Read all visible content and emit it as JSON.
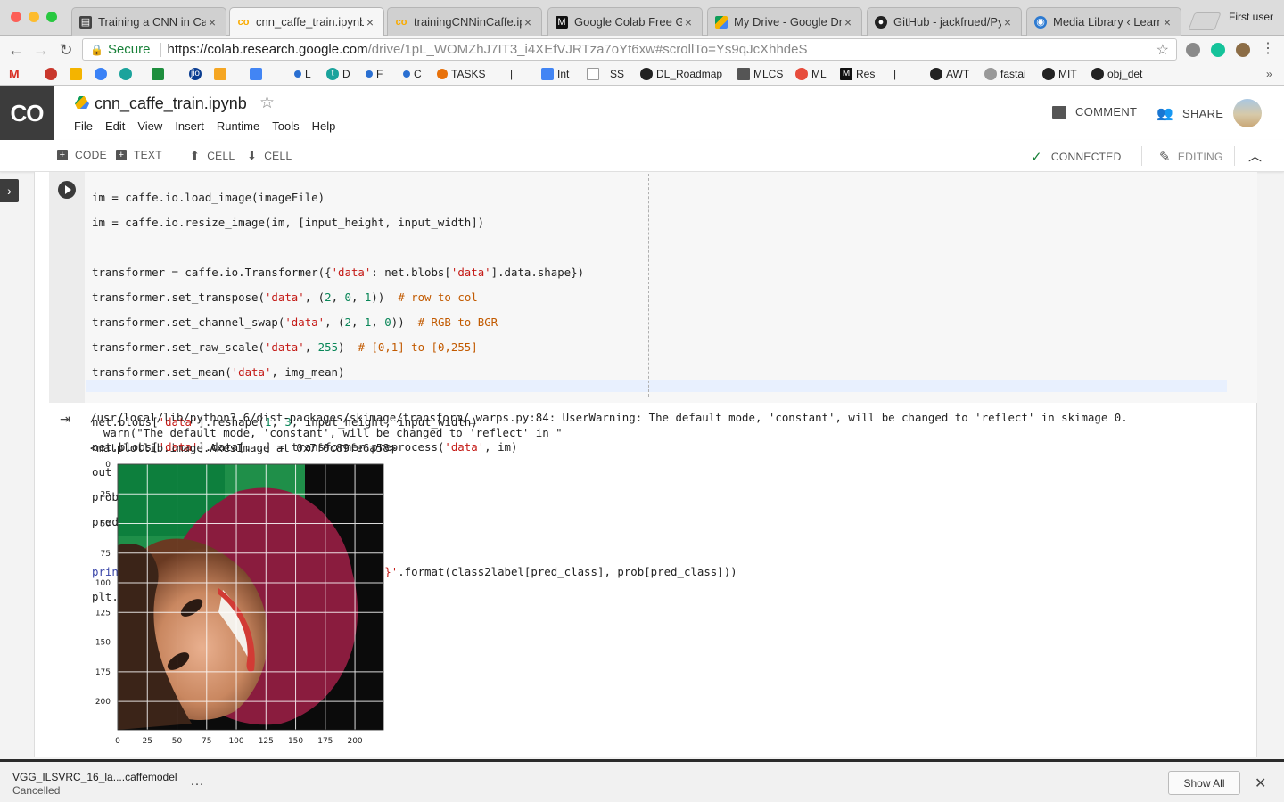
{
  "browser": {
    "tabs": [
      {
        "title": "Training a CNN in Caf",
        "favicon": "doc-icon",
        "active": false
      },
      {
        "title": "cnn_caffe_train.ipynb",
        "favicon": "colab-icon",
        "active": true
      },
      {
        "title": "trainingCNNinCaffe.ip",
        "favicon": "colab-icon",
        "active": false
      },
      {
        "title": "Google Colab Free GP",
        "favicon": "medium-icon",
        "active": false
      },
      {
        "title": "My Drive - Google Dri",
        "favicon": "drive-icon",
        "active": false
      },
      {
        "title": "GitHub - jackfrued/Py",
        "favicon": "github-icon",
        "active": false
      },
      {
        "title": "Media Library ‹ Learn",
        "favicon": "wordpress-icon",
        "active": false
      }
    ],
    "profile_label": "First user",
    "address": {
      "secure_label": "Secure",
      "host": "https://colab.research.google.com",
      "path": "/drive/1pL_WOMZhJ7IT3_i4XEfVJRTza7oYt6xw#scrollTo=Ys9qJcXhhdeS"
    },
    "bookmarks": [
      "L",
      "D",
      "F",
      "C",
      "TASKS",
      "|",
      "Int",
      "SS",
      "DL_Roadmap",
      "MLCS",
      "ML",
      "Res",
      "|",
      "AWT",
      "fastai",
      "MIT",
      "obj_det"
    ]
  },
  "colab": {
    "logo": "CO",
    "notebook_title": "cnn_caffe_train.ipynb",
    "menu": [
      "File",
      "Edit",
      "View",
      "Insert",
      "Runtime",
      "Tools",
      "Help"
    ],
    "comment_label": "COMMENT",
    "share_label": "SHARE",
    "toolbar": {
      "code": "CODE",
      "text": "TEXT",
      "cell_up": "CELL",
      "cell_down": "CELL",
      "connected": "CONNECTED",
      "editing": "EDITING"
    }
  },
  "output": {
    "lines": [
      "/usr/local/lib/python3.6/dist-packages/skimage/transform/_warps.py:84: UserWarning: The default mode, 'constant', will be changed to 'reflect' in skimage 0.",
      "  warn(\"The default mode, 'constant', will be changed to 'reflect' in \"",
      "<matplotlib.image.AxesImage at 0x7f0c89fe6a58>"
    ]
  },
  "plot": {
    "y_ticks": [
      "0",
      "25",
      "50",
      "75",
      "100",
      "125",
      "150",
      "175",
      "200"
    ],
    "x_ticks": [
      "0",
      "25",
      "50",
      "75",
      "100",
      "125",
      "150",
      "175",
      "200"
    ]
  },
  "download": {
    "filename": "VGG_ILSVRC_16_la....caffemodel",
    "status": "Cancelled",
    "show_all": "Show All"
  },
  "colors": {
    "accent_green": "#188038",
    "dark": "#3c3c3c"
  }
}
